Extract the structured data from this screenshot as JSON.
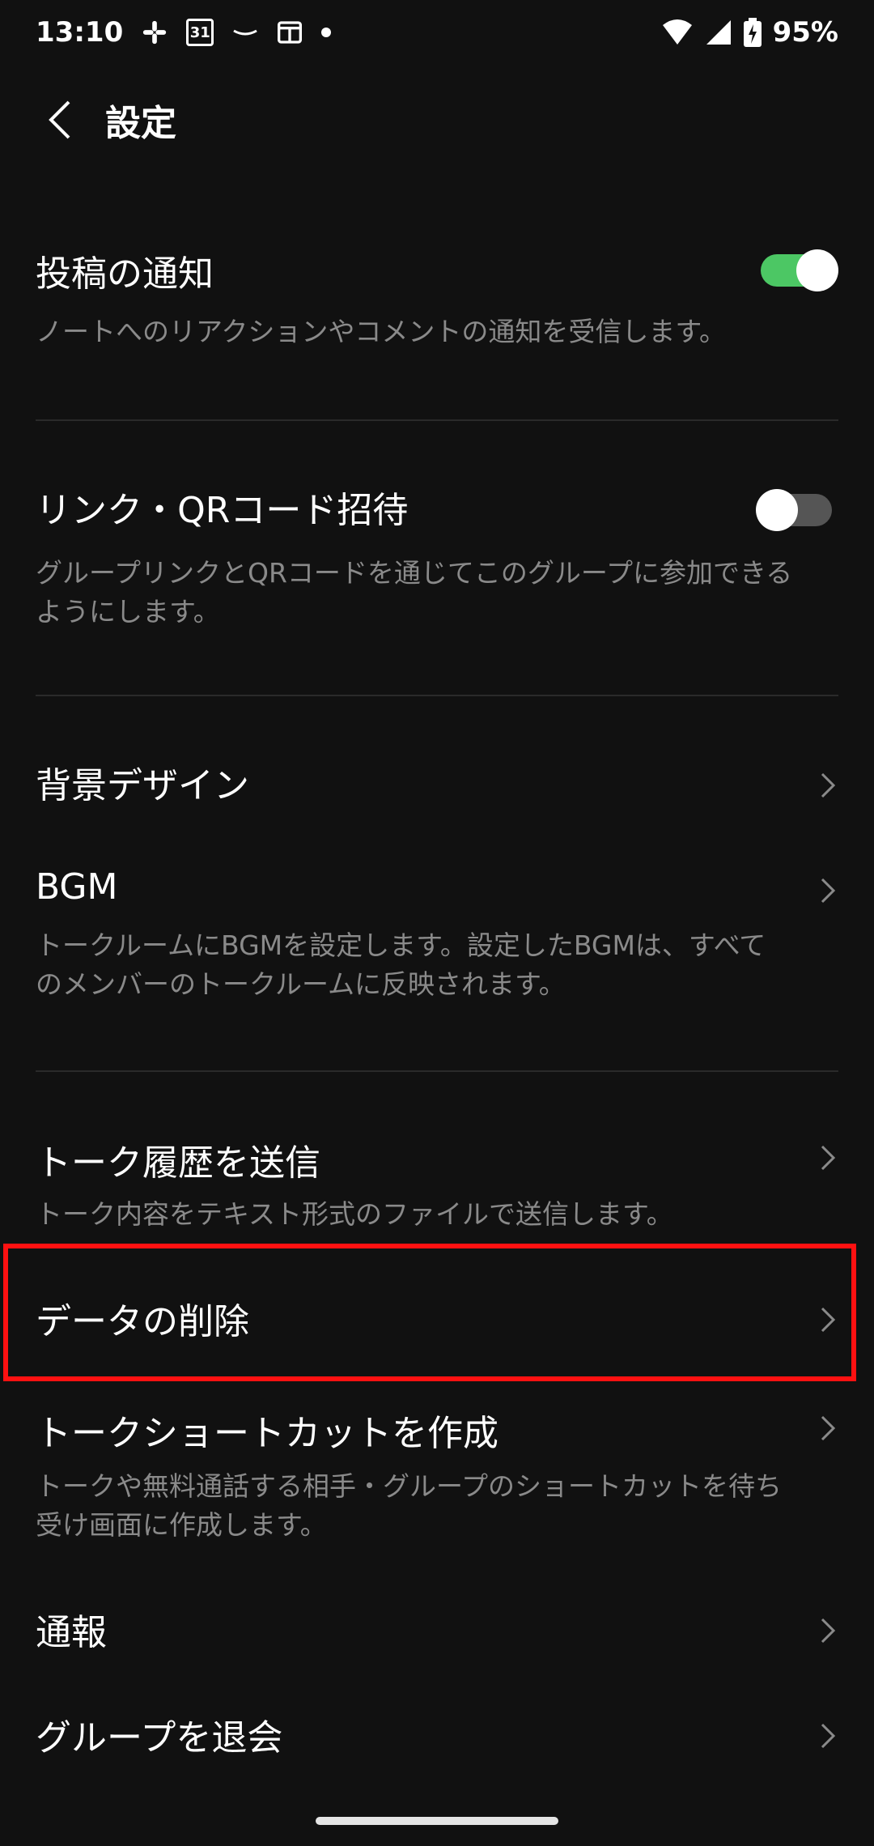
{
  "status_bar": {
    "time": "13:10",
    "calendar_day": "31",
    "battery": "95%",
    "icons": [
      "slack-icon",
      "calendar-icon",
      "amazon-icon",
      "news-icon",
      "dot-icon",
      "wifi-icon",
      "signal-icon",
      "battery-icon"
    ]
  },
  "header": {
    "title": "設定"
  },
  "settings": {
    "post_notify": {
      "title": "投稿の通知",
      "desc": "ノートへのリアクションやコメントの通知を受信します。",
      "toggle_on": true
    },
    "link_invite": {
      "title": "リンク・QRコード招待",
      "desc1": "グループリンクとQRコードを通じてこのグループに参加できる",
      "desc2": "ようにします。",
      "toggle_on": false
    },
    "background": {
      "title": "背景デザイン"
    },
    "bgm": {
      "title": "BGM",
      "desc1": "トークルームにBGMを設定します。設定したBGMは、すべて",
      "desc2": "のメンバーのトークルームに反映されます。"
    },
    "send_history": {
      "title": "トーク履歴を送信",
      "desc": "トーク内容をテキスト形式のファイルで送信します。"
    },
    "delete_data": {
      "title": "データの削除"
    },
    "shortcut": {
      "title": "トークショートカットを作成",
      "desc1": "トークや無料通話する相手・グループのショートカットを待ち",
      "desc2": "受け画面に作成します。"
    },
    "report": {
      "title": "通報"
    },
    "leave": {
      "title": "グループを退会"
    }
  },
  "colors": {
    "toggle_on": "#4cc764",
    "highlight": "#ff1111",
    "background": "#111111"
  }
}
